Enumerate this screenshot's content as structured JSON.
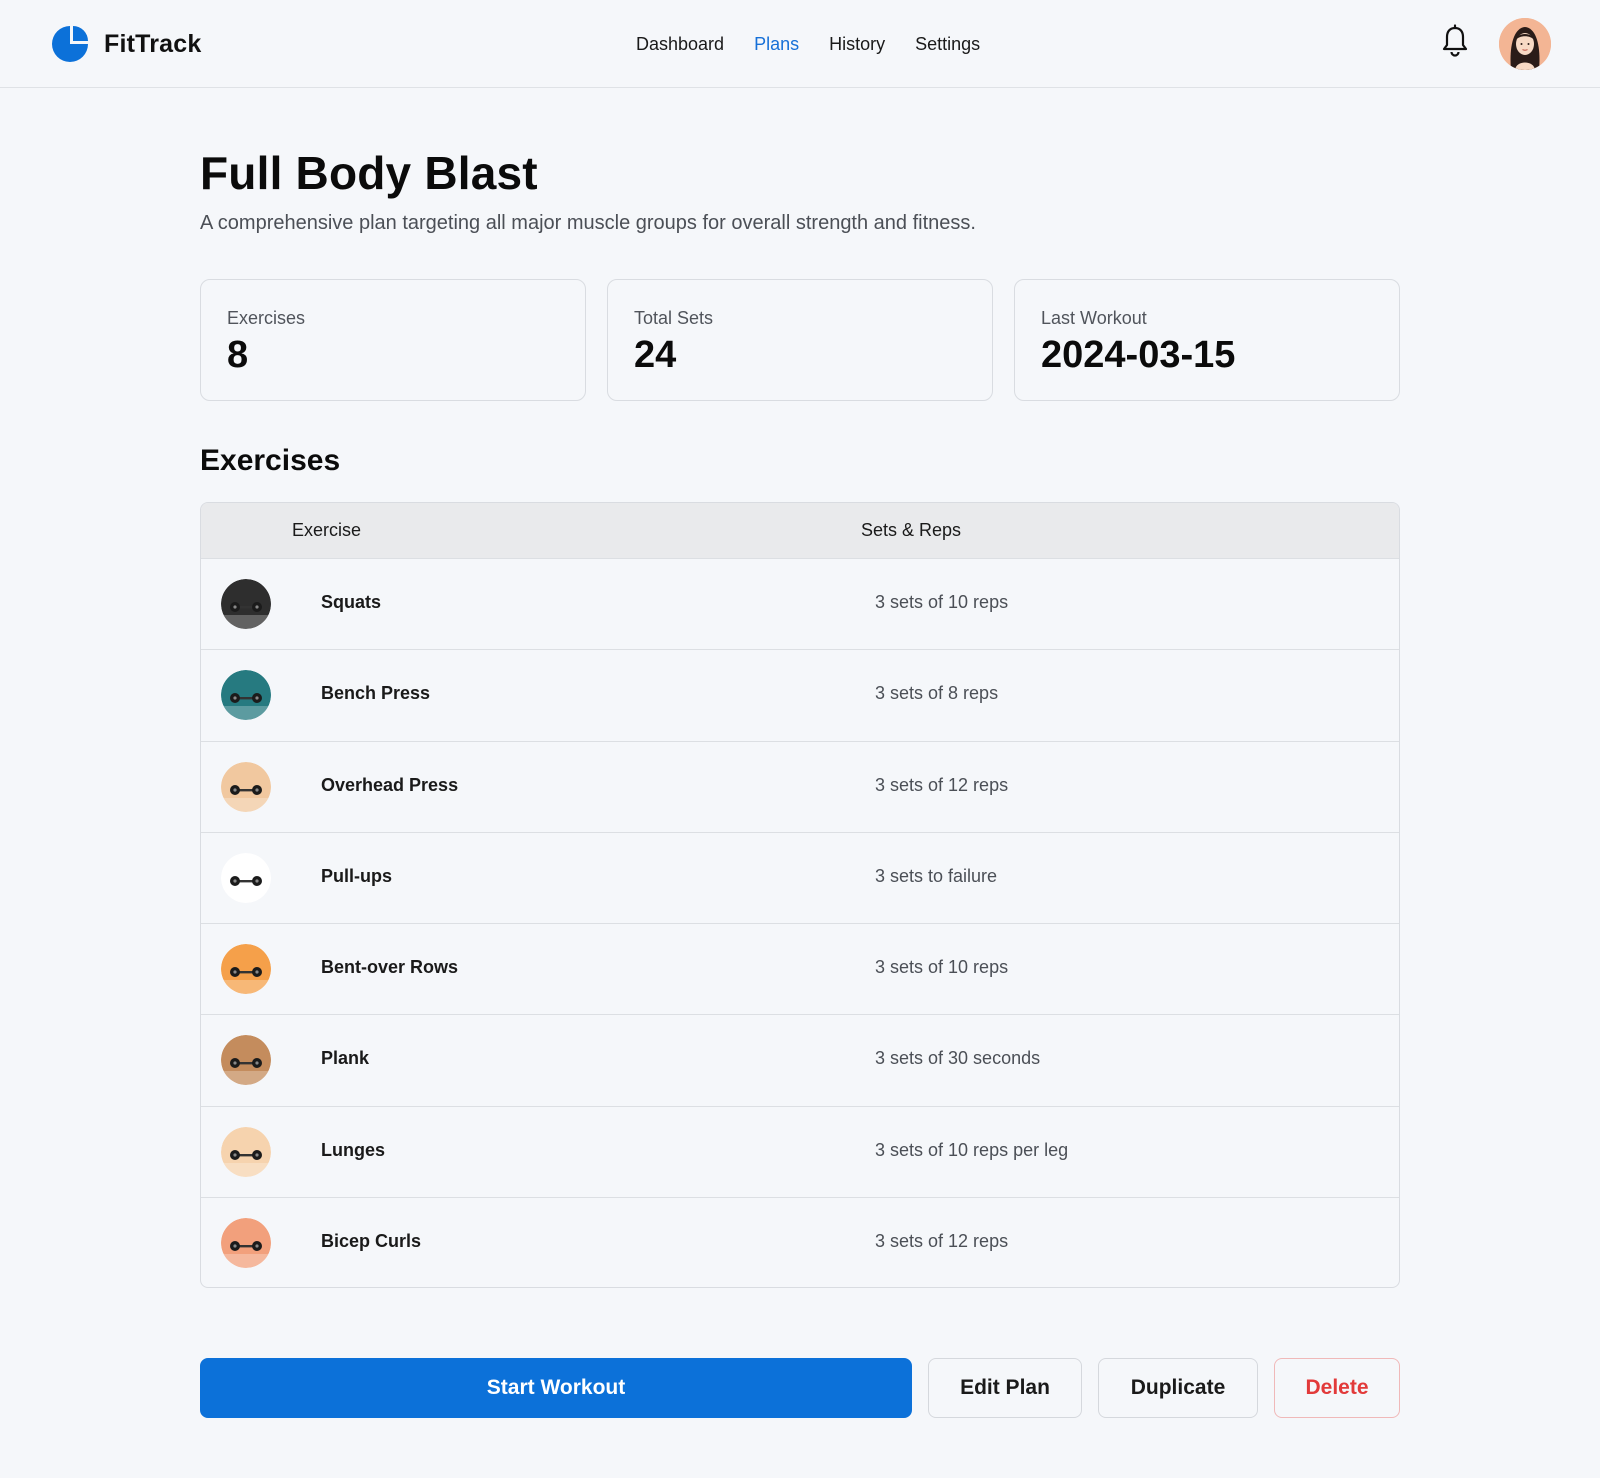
{
  "app": {
    "name": "FitTrack",
    "brand_color": "#0c71d9"
  },
  "nav": {
    "items": [
      {
        "label": "Dashboard",
        "active": false
      },
      {
        "label": "Plans",
        "active": true
      },
      {
        "label": "History",
        "active": false
      },
      {
        "label": "Settings",
        "active": false
      }
    ],
    "icons": [
      "bell-icon",
      "user-avatar"
    ]
  },
  "plan": {
    "title": "Full Body Blast",
    "description": "A comprehensive plan targeting all major muscle groups for overall strength and fitness."
  },
  "stats": [
    {
      "label": "Exercises",
      "value": "8"
    },
    {
      "label": "Total Sets",
      "value": "24"
    },
    {
      "label": "Last Workout",
      "value": "2024-03-15"
    }
  ],
  "exercises": {
    "section_title": "Exercises",
    "headers": {
      "exercise": "Exercise",
      "sets": "Sets & Reps"
    },
    "rows": [
      {
        "name": "Squats",
        "sets": "3 sets of 10 reps",
        "thumb_color": "#2e2e2e"
      },
      {
        "name": "Bench Press",
        "sets": "3 sets of 8 reps",
        "thumb_color": "#267a80"
      },
      {
        "name": "Overhead Press",
        "sets": "3 sets of 12 reps",
        "thumb_color": "#f1c89f"
      },
      {
        "name": "Pull-ups",
        "sets": "3 sets to failure",
        "thumb_color": "#ffffff"
      },
      {
        "name": "Bent-over Rows",
        "sets": "3 sets of 10 reps",
        "thumb_color": "#f5a04a"
      },
      {
        "name": "Plank",
        "sets": "3 sets of 30 seconds",
        "thumb_color": "#c48c5d"
      },
      {
        "name": "Lunges",
        "sets": "3 sets of 10 reps per leg",
        "thumb_color": "#f6d3ae"
      },
      {
        "name": "Bicep Curls",
        "sets": "3 sets of 12 reps",
        "thumb_color": "#f2a07c"
      }
    ]
  },
  "actions": {
    "start": "Start Workout",
    "edit": "Edit Plan",
    "duplicate": "Duplicate",
    "delete": "Delete"
  }
}
